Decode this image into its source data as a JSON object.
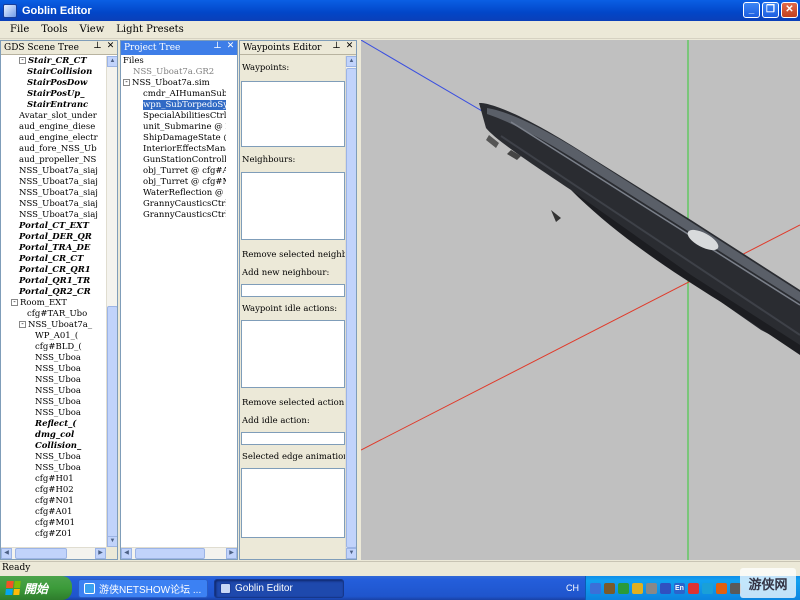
{
  "window": {
    "title": "Goblin Editor"
  },
  "menu": [
    "File",
    "Tools",
    "View",
    "Light Presets"
  ],
  "scene_tree": {
    "header": "GDS Scene Tree",
    "rows": [
      {
        "text": "Stair_CR_CT",
        "indent": 2,
        "style": "bi",
        "twisty": "-"
      },
      {
        "text": "StairCollision",
        "indent": 3,
        "style": "bi"
      },
      {
        "text": "StairPosDow",
        "indent": 3,
        "style": "bi"
      },
      {
        "text": "StairPosUp_",
        "indent": 3,
        "style": "bi"
      },
      {
        "text": "StairEntranc",
        "indent": 3,
        "style": "bi"
      },
      {
        "text": "Avatar_slot_under",
        "indent": 2
      },
      {
        "text": "aud_engine_diese",
        "indent": 2
      },
      {
        "text": "aud_engine_electr",
        "indent": 2
      },
      {
        "text": "aud_fore_NSS_Ub",
        "indent": 2
      },
      {
        "text": "aud_propeller_NS",
        "indent": 2
      },
      {
        "text": "NSS_Uboat7a_siaj",
        "indent": 2
      },
      {
        "text": "NSS_Uboat7a_siaj",
        "indent": 2
      },
      {
        "text": "NSS_Uboat7a_siaj",
        "indent": 2
      },
      {
        "text": "NSS_Uboat7a_siaj",
        "indent": 2
      },
      {
        "text": "NSS_Uboat7a_siaj",
        "indent": 2
      },
      {
        "text": "Portal_CT_EXT",
        "indent": 2,
        "style": "bi"
      },
      {
        "text": "Portal_DER_QR",
        "indent": 2,
        "style": "bi"
      },
      {
        "text": "Portal_TRA_DE",
        "indent": 2,
        "style": "bi"
      },
      {
        "text": "Portal_CR_CT",
        "indent": 2,
        "style": "bi"
      },
      {
        "text": "Portal_CR_QR1",
        "indent": 2,
        "style": "bi"
      },
      {
        "text": "Portal_QR1_TR",
        "indent": 2,
        "style": "bi"
      },
      {
        "text": "Portal_QR2_CR",
        "indent": 2,
        "style": "bi"
      },
      {
        "text": "Room_EXT",
        "indent": 1,
        "twisty": "-"
      },
      {
        "text": "cfg#TAR_Ubo",
        "indent": 3
      },
      {
        "text": "NSS_Uboat7a_",
        "indent": 2,
        "twisty": "-"
      },
      {
        "text": "WP_A01_(",
        "indent": 4
      },
      {
        "text": "cfg#BLD_(",
        "indent": 4
      },
      {
        "text": "NSS_Uboa",
        "indent": 4
      },
      {
        "text": "NSS_Uboa",
        "indent": 4
      },
      {
        "text": "NSS_Uboa",
        "indent": 4
      },
      {
        "text": "NSS_Uboa",
        "indent": 4
      },
      {
        "text": "NSS_Uboa",
        "indent": 4
      },
      {
        "text": "NSS_Uboa",
        "indent": 4
      },
      {
        "text": "Reflect_(",
        "indent": 4,
        "style": "bi"
      },
      {
        "text": "dmg_col",
        "indent": 4,
        "style": "bi"
      },
      {
        "text": "Collision_",
        "indent": 4,
        "style": "bi"
      },
      {
        "text": "NSS_Uboa",
        "indent": 4
      },
      {
        "text": "NSS_Uboa",
        "indent": 4
      },
      {
        "text": "cfg#H01",
        "indent": 4
      },
      {
        "text": "cfg#H02",
        "indent": 4
      },
      {
        "text": "cfg#N01",
        "indent": 4
      },
      {
        "text": "cfg#A01",
        "indent": 4
      },
      {
        "text": "cfg#M01",
        "indent": 4
      },
      {
        "text": "cfg#Z01",
        "indent": 4
      }
    ]
  },
  "project_tree": {
    "header": "Project Tree",
    "rows": [
      {
        "text": "Files",
        "indent": 0
      },
      {
        "text": "NSS_Uboat7a.GR2",
        "indent": 1,
        "style": "grey"
      },
      {
        "text": "NSS_Uboat7a.sim",
        "indent": 0,
        "twisty": "-"
      },
      {
        "text": "cmdr_AIHumanSub @",
        "indent": 2
      },
      {
        "text": "wpn_SubTorpedoSys",
        "indent": 2,
        "style": "selected"
      },
      {
        "text": "SpecialAbilitiesCtrl @",
        "indent": 2
      },
      {
        "text": "unit_Submarine @ NS",
        "indent": 2
      },
      {
        "text": "ShipDamageState @ N",
        "indent": 2
      },
      {
        "text": "InteriorEffectsManage",
        "indent": 2
      },
      {
        "text": "GunStationControllerI",
        "indent": 2
      },
      {
        "text": "obj_Turret @ cfg#A01",
        "indent": 2
      },
      {
        "text": "obj_Turret @ cfg#M0",
        "indent": 2
      },
      {
        "text": "WaterReflection @ Re",
        "indent": 2
      },
      {
        "text": "GrannyCausticsCtrl @",
        "indent": 2
      },
      {
        "text": "GrannyCausticsCtrl @",
        "indent": 2
      }
    ]
  },
  "waypoints": {
    "header": "Waypoints Editor",
    "waypoints_label": "Waypoints:",
    "neighbours_label": "Neighbours:",
    "remove_neighbour": "Remove selected neighbour",
    "add_neighbour": "Add new neighbour:",
    "idle_actions_label": "Waypoint idle actions:",
    "remove_action": "Remove selected action:",
    "add_idle_action": "Add idle action:",
    "edge_animations_label": "Selected edge animations:"
  },
  "status": "Ready",
  "taskbar": {
    "start": "開始",
    "tasks": [
      "游侠NETSHOW论坛 ...",
      "Goblin Editor"
    ],
    "lang": "CH",
    "tray_en": "En",
    "watermark": "游侠网"
  },
  "colors": {
    "viewport_bg": "#c0c0c0",
    "axis_x": "#e03a2a",
    "axis_y": "#33cc33",
    "axis_z": "#3a4fe0",
    "selection": "#316ac5"
  }
}
